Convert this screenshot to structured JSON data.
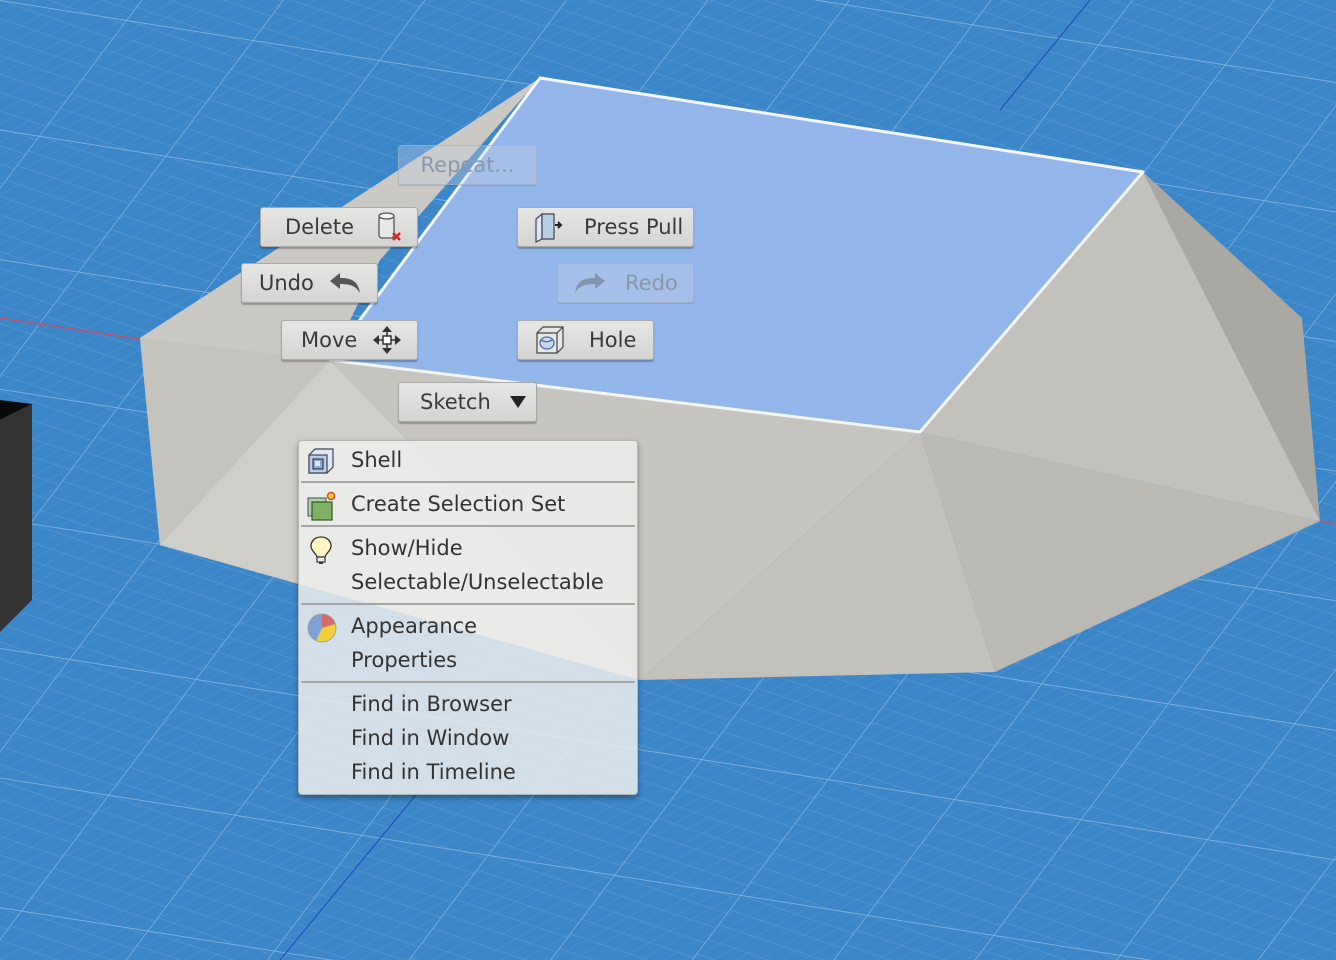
{
  "viewport": {
    "background_color": "#3b86c8",
    "grid_line_color": "#7fb0dc",
    "selected_face_color": "#92b6ea",
    "body_color": "#c4c3bd",
    "x_axis_color": "#c0506a",
    "y_axis_color": "#1f4fc0"
  },
  "marking_menu": {
    "repeat": {
      "label": "Repeat...",
      "enabled": false
    },
    "delete": {
      "label": "Delete",
      "icon": "delete-body-icon",
      "enabled": true
    },
    "press_pull": {
      "label": "Press Pull",
      "icon": "press-pull-icon",
      "enabled": true
    },
    "undo": {
      "label": "Undo",
      "icon": "undo-arrow-icon",
      "enabled": true
    },
    "redo": {
      "label": "Redo",
      "icon": "redo-arrow-icon",
      "enabled": false
    },
    "move": {
      "label": "Move",
      "icon": "move-arrows-icon",
      "enabled": true
    },
    "hole": {
      "label": "Hole",
      "icon": "hole-icon",
      "enabled": true
    },
    "sketch": {
      "label": "Sketch",
      "icon": "dropdown-triangle-icon",
      "enabled": true
    }
  },
  "context_menu": {
    "groups": [
      [
        {
          "label": "Shell",
          "icon": "shell-icon"
        }
      ],
      [
        {
          "label": "Create Selection Set",
          "icon": "selection-set-icon"
        }
      ],
      [
        {
          "label": "Show/Hide",
          "icon": "lightbulb-icon"
        },
        {
          "label": "Selectable/Unselectable",
          "icon": ""
        }
      ],
      [
        {
          "label": "Appearance",
          "icon": "appearance-icon"
        },
        {
          "label": "Properties",
          "icon": ""
        }
      ],
      [
        {
          "label": "Find in Browser",
          "icon": ""
        },
        {
          "label": "Find in Window",
          "icon": ""
        },
        {
          "label": "Find in Timeline",
          "icon": ""
        }
      ]
    ]
  }
}
